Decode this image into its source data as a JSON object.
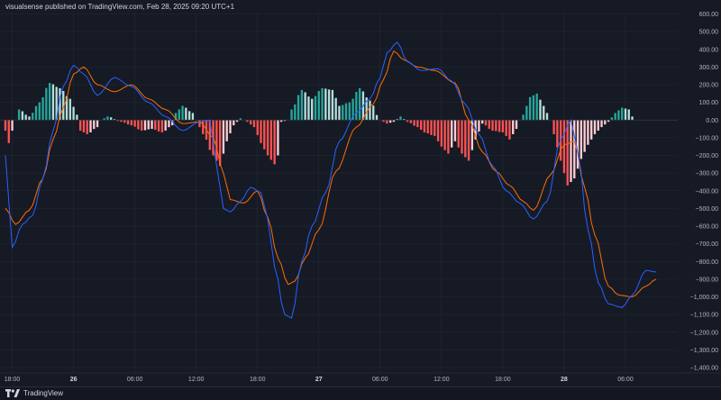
{
  "header": {
    "published_text": "visualsense published on TradingView.com, Feb 28, 2025 09:20 UTC+1"
  },
  "footer": {
    "logo_text": "TradingView"
  },
  "colors": {
    "background": "#161a25",
    "grid": "#242936",
    "macd_line": "#2962ff",
    "signal_line": "#ff6d00",
    "hist_pos_strong": "#26a69a",
    "hist_pos_weak": "#b2dfdb",
    "hist_neg_strong": "#ff5252",
    "hist_neg_weak": "#ffcdd2"
  },
  "chart_data": {
    "type": "line",
    "title": "",
    "xlabel": "",
    "ylabel": "",
    "ylim": [
      -1400,
      600
    ],
    "y_ticks": [
      "600.00",
      "500.00",
      "400.00",
      "300.00",
      "200.00",
      "100.00",
      "0.00",
      "−100.00",
      "−200.00",
      "−300.00",
      "−400.00",
      "−500.00",
      "−600.00",
      "−700.00",
      "−800.00",
      "−900.00",
      "−1,000.00",
      "−1,100.00",
      "−1,200.00",
      "−1,300.00",
      "−1,400.00"
    ],
    "y_tick_values": [
      600,
      500,
      400,
      300,
      200,
      100,
      0,
      -100,
      -200,
      -300,
      -400,
      -500,
      -600,
      -700,
      -800,
      -900,
      -1000,
      -1100,
      -1200,
      -1300,
      -1400
    ],
    "x_ticks": [
      {
        "label": "18:00",
        "bar": 2,
        "bold": false
      },
      {
        "label": "26",
        "bar": 20,
        "bold": true
      },
      {
        "label": "06:00",
        "bar": 38,
        "bold": false
      },
      {
        "label": "12:00",
        "bar": 56,
        "bold": false
      },
      {
        "label": "18:00",
        "bar": 74,
        "bold": false
      },
      {
        "label": "27",
        "bar": 92,
        "bold": true
      },
      {
        "label": "06:00",
        "bar": 110,
        "bold": false
      },
      {
        "label": "12:00",
        "bar": 128,
        "bold": false
      },
      {
        "label": "18:00",
        "bar": 146,
        "bold": false
      },
      {
        "label": "28",
        "bar": 164,
        "bold": true
      },
      {
        "label": "06:00",
        "bar": 182,
        "bold": false
      }
    ],
    "bar_count": 192,
    "series": [
      {
        "role": "macd",
        "keys": [
          [
            0,
            -200
          ],
          [
            2,
            -720
          ],
          [
            5,
            -590
          ],
          [
            8,
            -540
          ],
          [
            11,
            -330
          ],
          [
            14,
            -60
          ],
          [
            17,
            190
          ],
          [
            20,
            310
          ],
          [
            23,
            260
          ],
          [
            27,
            140
          ],
          [
            32,
            240
          ],
          [
            37,
            190
          ],
          [
            42,
            100
          ],
          [
            47,
            20
          ],
          [
            52,
            -60
          ],
          [
            57,
            -10
          ],
          [
            60,
            0
          ],
          [
            62,
            -260
          ],
          [
            64,
            -500
          ],
          [
            66,
            -520
          ],
          [
            69,
            -460
          ],
          [
            72,
            -380
          ],
          [
            75,
            -410
          ],
          [
            77,
            -560
          ],
          [
            79,
            -830
          ],
          [
            82,
            -1100
          ],
          [
            84,
            -1120
          ],
          [
            87,
            -800
          ],
          [
            90,
            -600
          ],
          [
            94,
            -410
          ],
          [
            98,
            -120
          ],
          [
            103,
            40
          ],
          [
            107,
            120
          ],
          [
            110,
            240
          ],
          [
            112,
            380
          ],
          [
            115,
            440
          ],
          [
            118,
            330
          ],
          [
            122,
            280
          ],
          [
            127,
            290
          ],
          [
            131,
            220
          ],
          [
            135,
            90
          ],
          [
            139,
            -80
          ],
          [
            143,
            -260
          ],
          [
            147,
            -400
          ],
          [
            151,
            -470
          ],
          [
            155,
            -560
          ],
          [
            159,
            -460
          ],
          [
            163,
            -110
          ],
          [
            166,
            0
          ],
          [
            168,
            -180
          ],
          [
            171,
            -620
          ],
          [
            174,
            -920
          ],
          [
            177,
            -1040
          ],
          [
            181,
            -1060
          ],
          [
            184,
            -990
          ],
          [
            188,
            -850
          ],
          [
            191,
            -860
          ]
        ]
      },
      {
        "role": "signal",
        "keys": [
          [
            0,
            -500
          ],
          [
            3,
            -590
          ],
          [
            7,
            -510
          ],
          [
            11,
            -330
          ],
          [
            14,
            -110
          ],
          [
            17,
            70
          ],
          [
            20,
            260
          ],
          [
            23,
            300
          ],
          [
            27,
            200
          ],
          [
            32,
            160
          ],
          [
            37,
            200
          ],
          [
            42,
            120
          ],
          [
            47,
            60
          ],
          [
            52,
            -20
          ],
          [
            57,
            -10
          ],
          [
            61,
            -100
          ],
          [
            64,
            -300
          ],
          [
            66,
            -450
          ],
          [
            70,
            -470
          ],
          [
            74,
            -400
          ],
          [
            77,
            -550
          ],
          [
            80,
            -780
          ],
          [
            83,
            -930
          ],
          [
            85,
            -910
          ],
          [
            88,
            -780
          ],
          [
            92,
            -620
          ],
          [
            97,
            -290
          ],
          [
            103,
            -40
          ],
          [
            108,
            90
          ],
          [
            111,
            230
          ],
          [
            114,
            390
          ],
          [
            117,
            340
          ],
          [
            121,
            300
          ],
          [
            126,
            280
          ],
          [
            132,
            210
          ],
          [
            136,
            0
          ],
          [
            140,
            -180
          ],
          [
            144,
            -290
          ],
          [
            148,
            -370
          ],
          [
            152,
            -460
          ],
          [
            155,
            -510
          ],
          [
            160,
            -310
          ],
          [
            164,
            -140
          ],
          [
            167,
            -120
          ],
          [
            170,
            -380
          ],
          [
            173,
            -650
          ],
          [
            177,
            -940
          ],
          [
            180,
            -990
          ],
          [
            184,
            -1000
          ],
          [
            188,
            -940
          ],
          [
            191,
            -900
          ]
        ]
      },
      {
        "role": "histogram",
        "keys": [
          [
            0,
            -60
          ],
          [
            1,
            -130
          ],
          [
            2,
            -60
          ],
          [
            3,
            0
          ],
          [
            4,
            60
          ],
          [
            7,
            20
          ],
          [
            10,
            100
          ],
          [
            13,
            210
          ],
          [
            16,
            180
          ],
          [
            19,
            120
          ],
          [
            21,
            30
          ],
          [
            22,
            -60
          ],
          [
            24,
            -80
          ],
          [
            27,
            -40
          ],
          [
            28,
            0
          ],
          [
            30,
            20
          ],
          [
            34,
            -10
          ],
          [
            37,
            -30
          ],
          [
            40,
            -60
          ],
          [
            43,
            -50
          ],
          [
            46,
            -70
          ],
          [
            49,
            -30
          ],
          [
            50,
            40
          ],
          [
            52,
            80
          ],
          [
            55,
            40
          ],
          [
            56,
            0
          ],
          [
            58,
            -80
          ],
          [
            61,
            -200
          ],
          [
            63,
            -260
          ],
          [
            65,
            -120
          ],
          [
            67,
            -30
          ],
          [
            69,
            10
          ],
          [
            71,
            -10
          ],
          [
            73,
            -40
          ],
          [
            75,
            -130
          ],
          [
            77,
            -200
          ],
          [
            79,
            -250
          ],
          [
            80,
            -200
          ],
          [
            81,
            -10
          ],
          [
            83,
            0
          ],
          [
            84,
            60
          ],
          [
            87,
            170
          ],
          [
            90,
            120
          ],
          [
            93,
            180
          ],
          [
            96,
            170
          ],
          [
            98,
            80
          ],
          [
            101,
            100
          ],
          [
            104,
            180
          ],
          [
            107,
            110
          ],
          [
            110,
            0
          ],
          [
            112,
            -20
          ],
          [
            114,
            -10
          ],
          [
            116,
            20
          ],
          [
            118,
            -10
          ],
          [
            121,
            -40
          ],
          [
            123,
            -70
          ],
          [
            126,
            -90
          ],
          [
            128,
            -150
          ],
          [
            130,
            -190
          ],
          [
            132,
            -120
          ],
          [
            134,
            -190
          ],
          [
            136,
            -230
          ],
          [
            138,
            -110
          ],
          [
            140,
            -20
          ],
          [
            143,
            -60
          ],
          [
            146,
            -70
          ],
          [
            148,
            -110
          ],
          [
            150,
            -50
          ],
          [
            151,
            0
          ],
          [
            152,
            30
          ],
          [
            154,
            130
          ],
          [
            156,
            150
          ],
          [
            158,
            80
          ],
          [
            160,
            0
          ],
          [
            161,
            -80
          ],
          [
            163,
            -230
          ],
          [
            165,
            -370
          ],
          [
            167,
            -330
          ],
          [
            169,
            -220
          ],
          [
            171,
            -140
          ],
          [
            173,
            -80
          ],
          [
            175,
            -40
          ],
          [
            177,
            -10
          ],
          [
            179,
            40
          ],
          [
            181,
            70
          ],
          [
            183,
            60
          ],
          [
            184,
            20
          ],
          [
            185,
            0
          ]
        ]
      }
    ]
  }
}
